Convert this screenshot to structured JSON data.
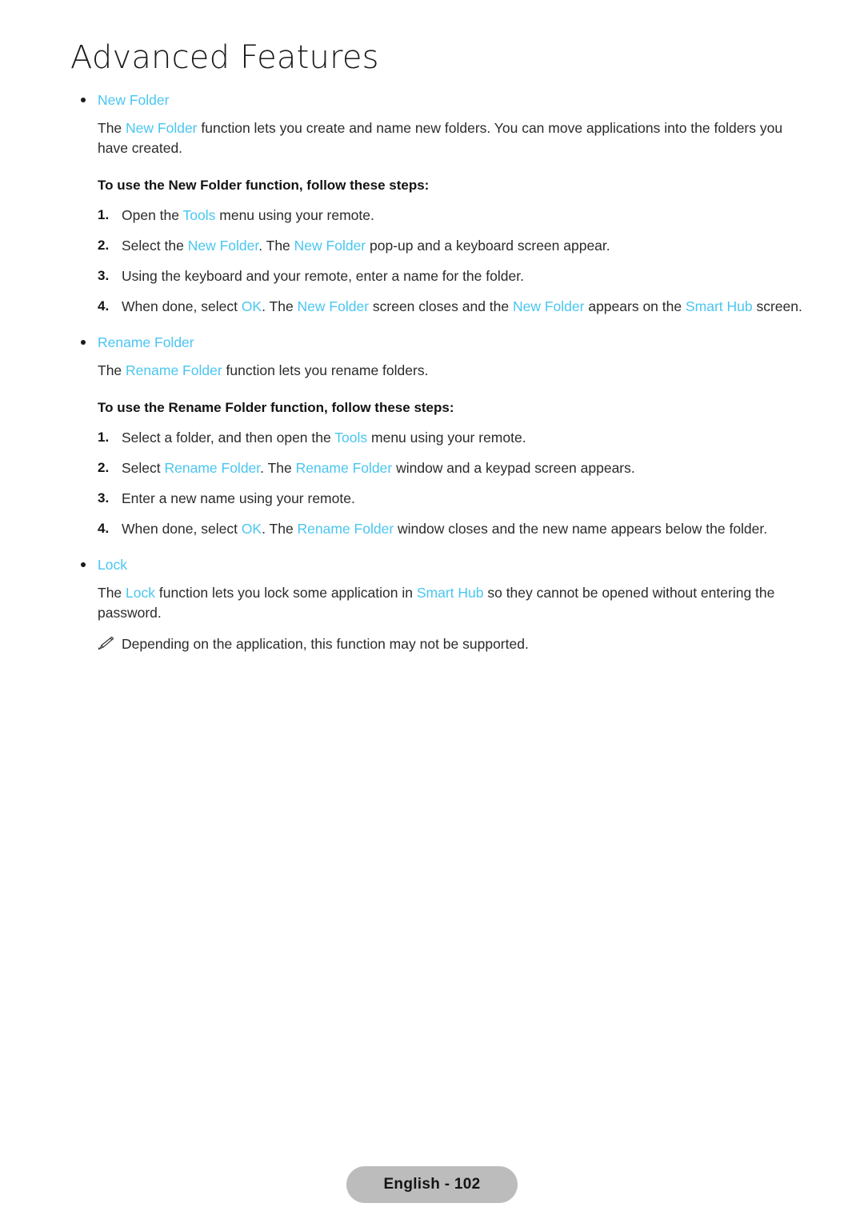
{
  "page": {
    "chapter_title": "Advanced Features",
    "footer_label": "English - 102",
    "accent_color": "#4ac6f0",
    "text_color": "#2b2b2b",
    "footer_bg": "#bcbcbc"
  },
  "sections": {
    "new_folder": {
      "bullet_label": "New Folder",
      "intro_a": "The ",
      "intro_term": "New Folder",
      "intro_b": " function lets you create and name new folders. You can move applications into the folders you have created.",
      "steps_heading": "To use the New Folder function, follow these steps:",
      "steps": {
        "n1": "1.",
        "n2": "2.",
        "n3": "3.",
        "n4": "4.",
        "s1_a": "Open the ",
        "s1_t1": "Tools",
        "s1_b": " menu using your remote.",
        "s2_a": "Select the ",
        "s2_t1": "New Folder",
        "s2_b": ". The ",
        "s2_t2": "New Folder",
        "s2_c": " pop-up and a keyboard screen appear.",
        "s3_a": "Using the keyboard and your remote, enter a name for the folder.",
        "s4_a": "When done, select ",
        "s4_t1": "OK",
        "s4_b": ". The ",
        "s4_t2": "New Folder",
        "s4_c": " screen closes and the ",
        "s4_t3": "New Folder",
        "s4_d": " appears on the ",
        "s4_t4": "Smart Hub",
        "s4_e": " screen."
      }
    },
    "rename_folder": {
      "bullet_label": "Rename Folder",
      "intro_a": "The ",
      "intro_term": "Rename Folder",
      "intro_b": " function lets you rename folders.",
      "steps_heading": "To use the Rename Folder function, follow these steps:",
      "steps": {
        "n1": "1.",
        "n2": "2.",
        "n3": "3.",
        "n4": "4.",
        "s1_a": "Select a folder, and then open the ",
        "s1_t1": "Tools",
        "s1_b": " menu using your remote.",
        "s2_a": "Select ",
        "s2_t1": "Rename Folder",
        "s2_b": ". The ",
        "s2_t2": "Rename Folder",
        "s2_c": " window and a keypad screen appears.",
        "s3_a": "Enter a new name using your remote.",
        "s4_a": "When done, select ",
        "s4_t1": "OK",
        "s4_b": ". The ",
        "s4_t2": "Rename Folder",
        "s4_c": " window closes and the new name appears below the folder."
      }
    },
    "lock": {
      "bullet_label": "Lock",
      "intro_a": "The ",
      "intro_term": "Lock",
      "intro_b": " function lets you lock some application in ",
      "intro_term2": "Smart Hub",
      "intro_c": " so they cannot be opened without entering the password.",
      "note_icon": "pencil-note-icon",
      "note_text": "Depending on the application, this function may not be supported."
    }
  }
}
